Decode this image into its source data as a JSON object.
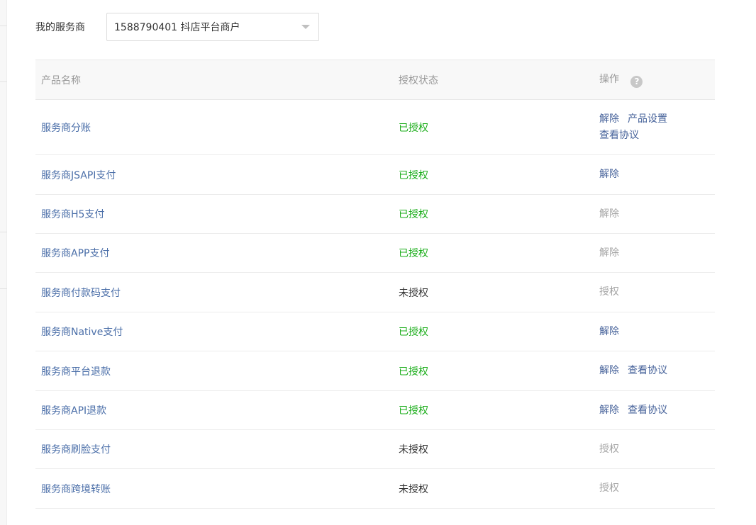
{
  "service_provider": {
    "label": "我的服务商",
    "selected": "1588790401 抖店平台商户"
  },
  "table": {
    "headers": {
      "name": "产品名称",
      "status": "授权状态",
      "actions": "操作",
      "help_icon": "?"
    },
    "rows": [
      {
        "name": "服务商分账",
        "status": "已授权",
        "authorized": true,
        "actions": [
          {
            "label": "解除",
            "enabled": true
          },
          {
            "label": "产品设置",
            "enabled": true
          },
          {
            "label": "查看协议",
            "enabled": true
          }
        ]
      },
      {
        "name": "服务商JSAPI支付",
        "status": "已授权",
        "authorized": true,
        "actions": [
          {
            "label": "解除",
            "enabled": true
          }
        ]
      },
      {
        "name": "服务商H5支付",
        "status": "已授权",
        "authorized": true,
        "actions": [
          {
            "label": "解除",
            "enabled": false
          }
        ]
      },
      {
        "name": "服务商APP支付",
        "status": "已授权",
        "authorized": true,
        "actions": [
          {
            "label": "解除",
            "enabled": false
          }
        ]
      },
      {
        "name": "服务商付款码支付",
        "status": "未授权",
        "authorized": false,
        "actions": [
          {
            "label": "授权",
            "enabled": false
          }
        ]
      },
      {
        "name": "服务商Native支付",
        "status": "已授权",
        "authorized": true,
        "actions": [
          {
            "label": "解除",
            "enabled": true
          }
        ]
      },
      {
        "name": "服务商平台退款",
        "status": "已授权",
        "authorized": true,
        "actions": [
          {
            "label": "解除",
            "enabled": true
          },
          {
            "label": "查看协议",
            "enabled": true
          }
        ]
      },
      {
        "name": "服务商API退款",
        "status": "已授权",
        "authorized": true,
        "actions": [
          {
            "label": "解除",
            "enabled": true
          },
          {
            "label": "查看协议",
            "enabled": true
          }
        ]
      },
      {
        "name": "服务商刷脸支付",
        "status": "未授权",
        "authorized": false,
        "actions": [
          {
            "label": "授权",
            "enabled": false
          }
        ]
      },
      {
        "name": "服务商跨境转账",
        "status": "未授权",
        "authorized": false,
        "actions": [
          {
            "label": "授权",
            "enabled": false
          }
        ]
      }
    ]
  },
  "colors": {
    "authorized": "#1aad19",
    "unauthorized": "#333333",
    "link": "#4a6ea8",
    "action": "#46629a",
    "action_disabled": "#a5a5a5"
  },
  "icons": {
    "dropdown": "chevron-down-icon",
    "help": "question-circle-icon"
  }
}
